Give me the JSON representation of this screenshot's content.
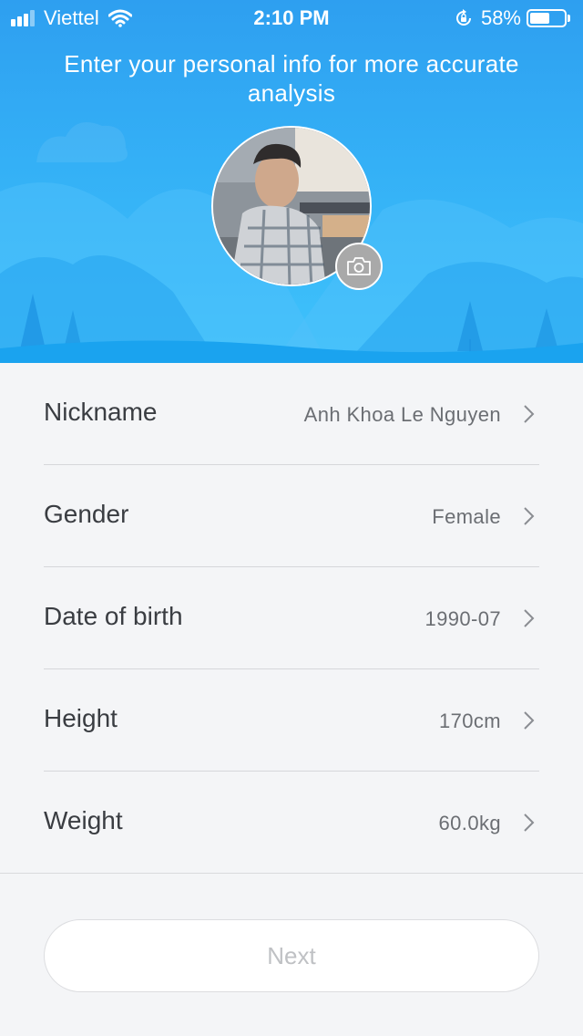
{
  "status_bar": {
    "carrier": "Viettel",
    "time": "2:10 PM",
    "battery_text": "58%",
    "battery_level": 0.58,
    "signal_bars": 3,
    "icons": [
      "signal-icon",
      "wifi-icon",
      "rotation-lock-icon",
      "battery-icon"
    ]
  },
  "header": {
    "title": "Enter your personal info for more accurate analysis",
    "background_color": "#34b0f6",
    "avatar_icon": "avatar-photo",
    "camera_icon": "camera-icon"
  },
  "profile_fields": [
    {
      "label": "Nickname",
      "value": "Anh Khoa Le Nguyen"
    },
    {
      "label": "Gender",
      "value": "Female"
    },
    {
      "label": "Date of birth",
      "value": "1990-07"
    },
    {
      "label": "Height",
      "value": "170cm"
    },
    {
      "label": "Weight",
      "value": "60.0kg"
    }
  ],
  "next_button": {
    "label": "Next",
    "enabled": false
  }
}
